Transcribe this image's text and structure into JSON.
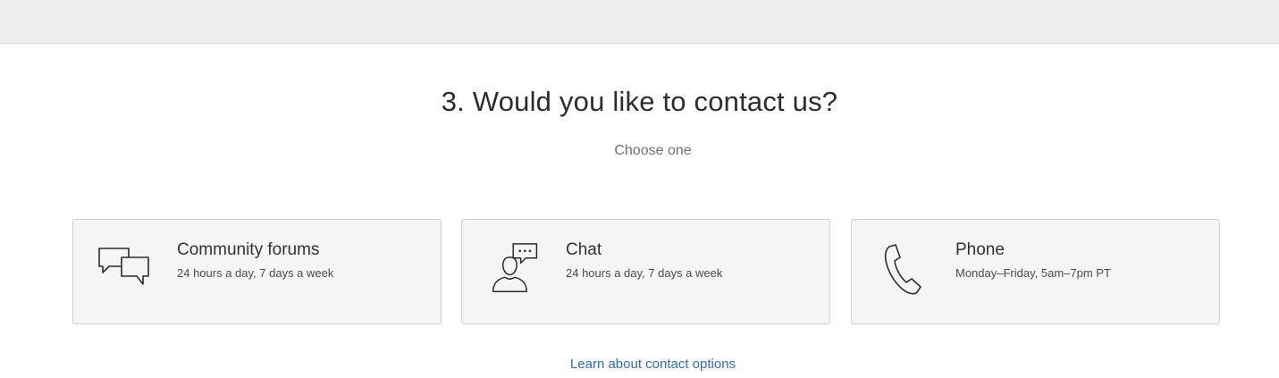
{
  "section": {
    "heading": "3. Would you like to contact us?",
    "subheading": "Choose one"
  },
  "options": [
    {
      "icon": "community-forums-icon",
      "title": "Community forums",
      "hours": "24 hours a day, 7 days a week"
    },
    {
      "icon": "chat-icon",
      "title": "Chat",
      "hours": "24 hours a day, 7 days a week"
    },
    {
      "icon": "phone-icon",
      "title": "Phone",
      "hours": "Monday–Friday, 5am–7pm PT"
    }
  ],
  "footer": {
    "learn_link": "Learn about contact options"
  },
  "colors": {
    "link": "#2d6eb5",
    "card_background": "#f5f5f5",
    "card_border": "#cfcfcf",
    "top_band": "#eeeeee"
  }
}
